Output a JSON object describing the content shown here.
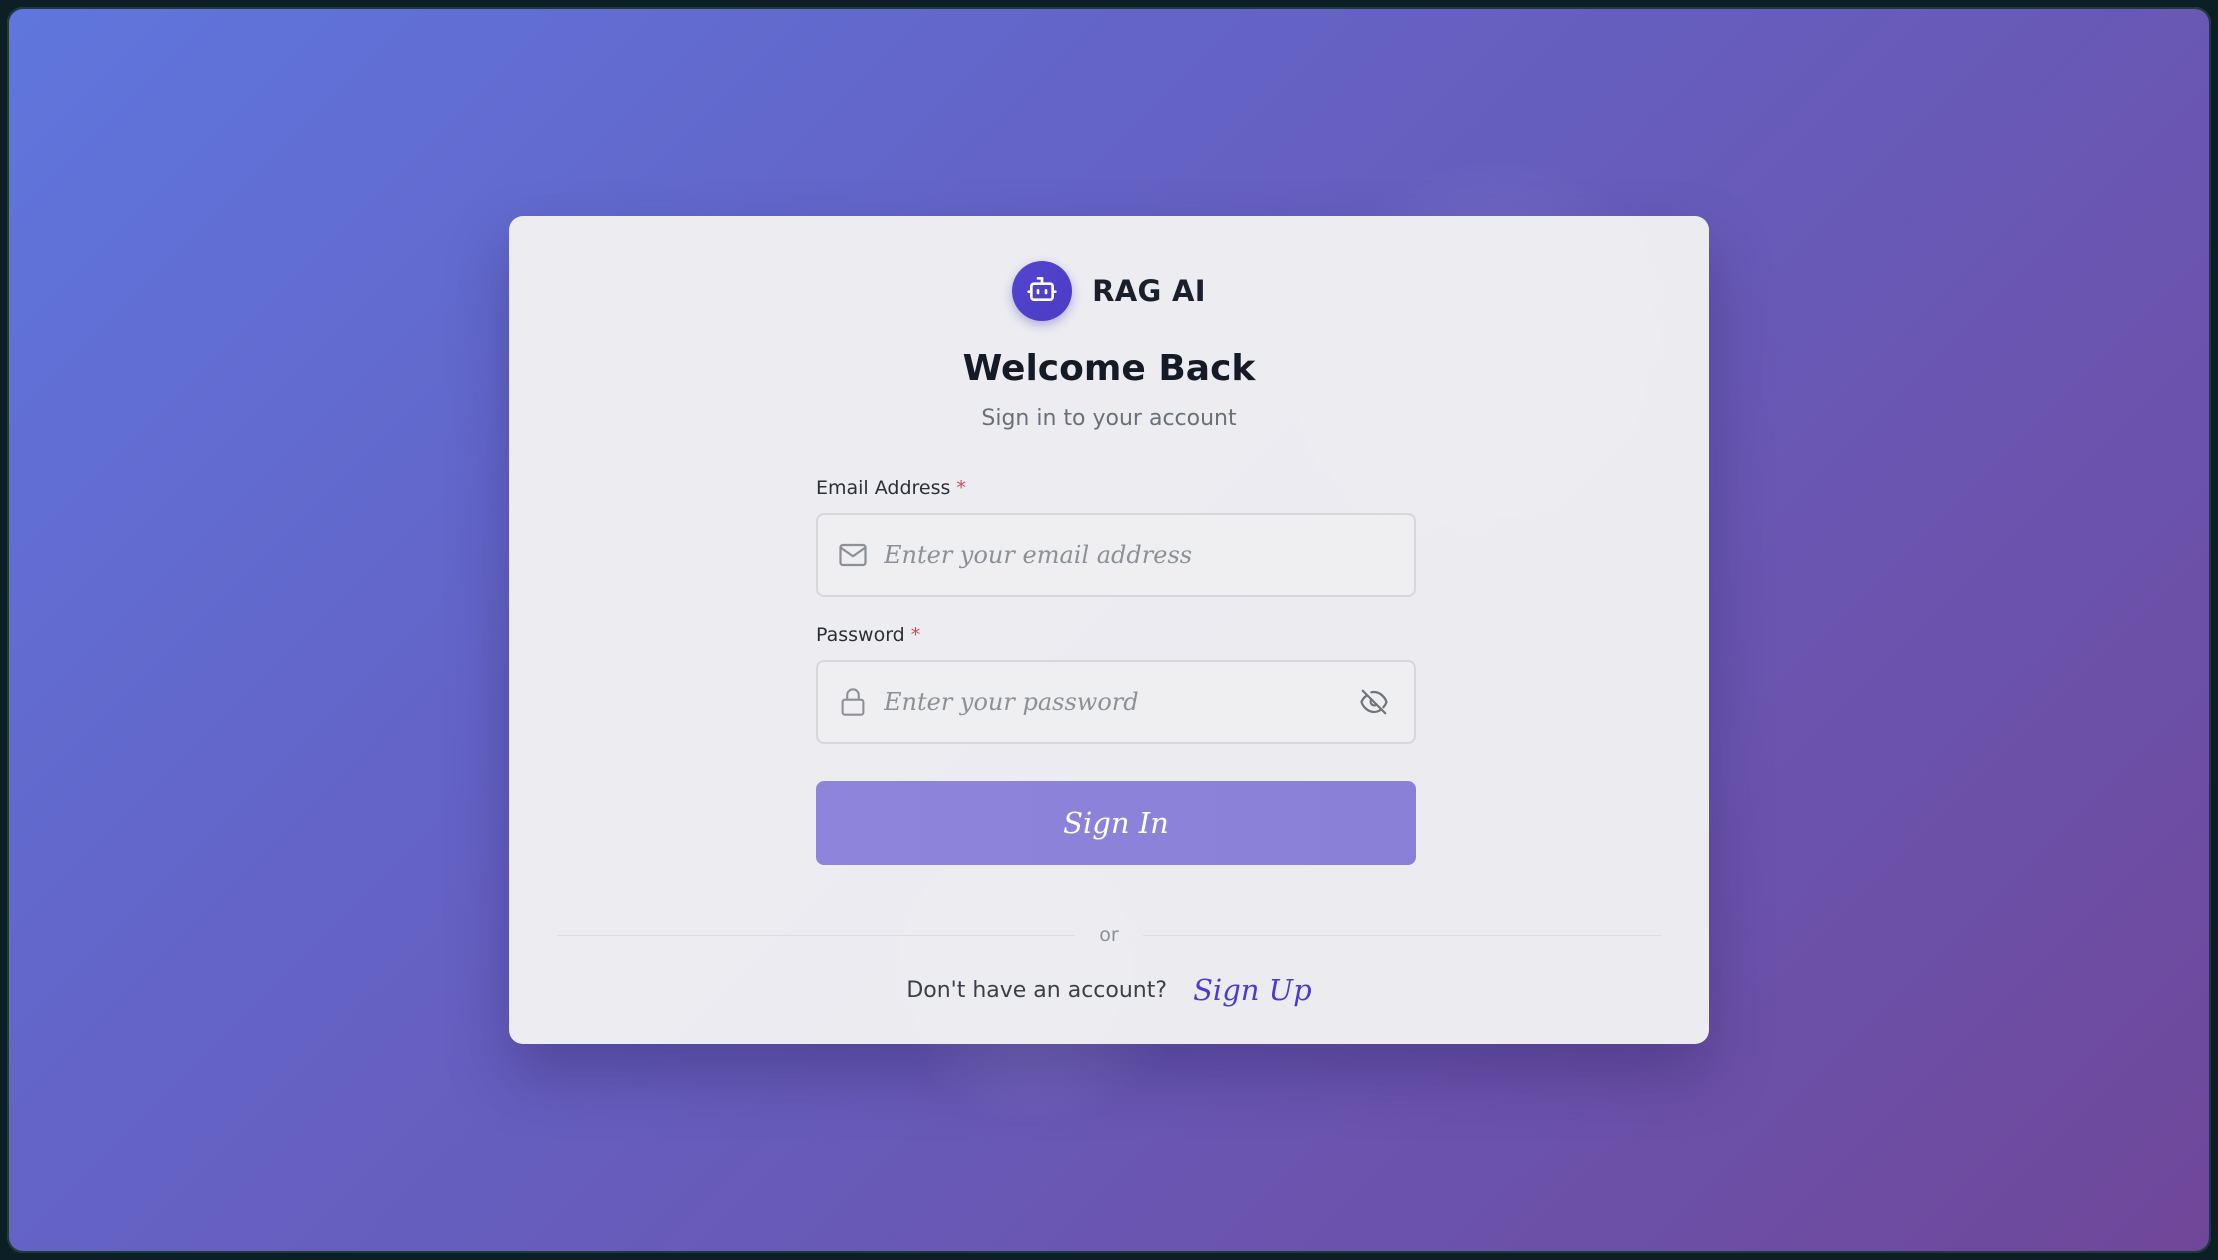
{
  "brand": {
    "name": "RAG AI",
    "logo_icon": "robot-icon",
    "accent": "#4f42cf"
  },
  "header": {
    "title": "Welcome Back",
    "subtitle": "Sign in to your account"
  },
  "form": {
    "email": {
      "label": "Email Address",
      "required_marker": "*",
      "placeholder": "Enter your email address",
      "value": "",
      "icon": "mail-icon"
    },
    "password": {
      "label": "Password",
      "required_marker": "*",
      "placeholder": "Enter your password",
      "value": "",
      "icon": "lock-icon",
      "toggle_icon": "eye-off-icon"
    },
    "submit_label": "Sign In",
    "submit_color": "#8c82da"
  },
  "divider": {
    "text": "or"
  },
  "footer": {
    "prompt": "Don't have an account?",
    "link_label": "Sign Up"
  },
  "colors": {
    "background_start": "#5f76dd",
    "background_end": "#6f4799",
    "required": "#e0454a"
  }
}
